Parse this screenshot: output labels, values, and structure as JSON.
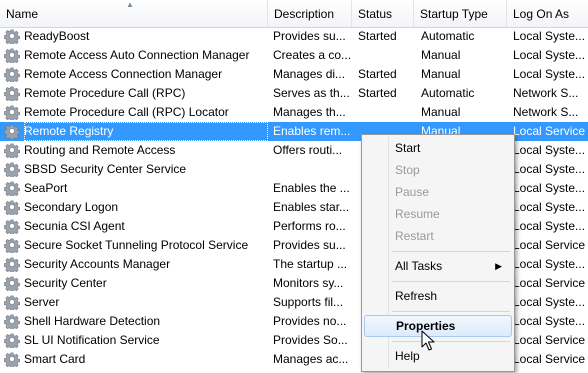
{
  "columns": {
    "name": "Name",
    "description": "Description",
    "status": "Status",
    "startup_type": "Startup Type",
    "log_on_as": "Log On As"
  },
  "services": [
    {
      "name": "ReadyBoost",
      "description": "Provides su...",
      "status": "Started",
      "startup": "Automatic",
      "logon": "Local Syste..."
    },
    {
      "name": "Remote Access Auto Connection Manager",
      "description": "Creates a co...",
      "status": "",
      "startup": "Manual",
      "logon": "Local Syste..."
    },
    {
      "name": "Remote Access Connection Manager",
      "description": "Manages di...",
      "status": "Started",
      "startup": "Manual",
      "logon": "Local Syste..."
    },
    {
      "name": "Remote Procedure Call (RPC)",
      "description": "Serves as th...",
      "status": "Started",
      "startup": "Automatic",
      "logon": "Network S..."
    },
    {
      "name": "Remote Procedure Call (RPC) Locator",
      "description": "Manages th...",
      "status": "",
      "startup": "Manual",
      "logon": "Network S..."
    },
    {
      "name": "Remote Registry",
      "description": "Enables rem...",
      "status": "",
      "startup": "Manual",
      "logon": "Local Service"
    },
    {
      "name": "Routing and Remote Access",
      "description": "Offers routi...",
      "status": "",
      "startup": "",
      "logon": "Local Syste..."
    },
    {
      "name": "SBSD Security Center Service",
      "description": "",
      "status": "",
      "startup": "",
      "logon": "Local Syste..."
    },
    {
      "name": "SeaPort",
      "description": "Enables the ...",
      "status": "",
      "startup": "",
      "logon": "Local Syste..."
    },
    {
      "name": "Secondary Logon",
      "description": "Enables star...",
      "status": "",
      "startup": "",
      "logon": "Local Syste..."
    },
    {
      "name": "Secunia CSI Agent",
      "description": "Performs ro...",
      "status": "",
      "startup": "",
      "logon": "Local Syste..."
    },
    {
      "name": "Secure Socket Tunneling Protocol Service",
      "description": "Provides su...",
      "status": "",
      "startup": "",
      "logon": "Local Service"
    },
    {
      "name": "Security Accounts Manager",
      "description": "The startup ...",
      "status": "",
      "startup": "",
      "logon": "Local Syste..."
    },
    {
      "name": "Security Center",
      "description": "Monitors sy...",
      "status": "",
      "startup": "",
      "logon": "Local Service"
    },
    {
      "name": "Server",
      "description": "Supports fil...",
      "status": "",
      "startup": "",
      "logon": "Local Syste..."
    },
    {
      "name": "Shell Hardware Detection",
      "description": "Provides no...",
      "status": "",
      "startup": "",
      "logon": "Local Syste..."
    },
    {
      "name": "SL UI Notification Service",
      "description": "Provides So...",
      "status": "",
      "startup": "",
      "logon": "Local Service"
    },
    {
      "name": "Smart Card",
      "description": "Manages ac...",
      "status": "",
      "startup": "",
      "logon": "Local Service"
    }
  ],
  "context_menu": {
    "start": "Start",
    "stop": "Stop",
    "pause": "Pause",
    "resume": "Resume",
    "restart": "Restart",
    "all_tasks": "All Tasks",
    "refresh": "Refresh",
    "properties": "Properties",
    "help": "Help"
  },
  "colors": {
    "selection": "#3399ff",
    "menu_hover": "#dcebfc"
  },
  "icons": {
    "service": "gear-icon",
    "submenu": "submenu-arrow-icon",
    "sort": "sort-ascending-icon",
    "pointer": "mouse-pointer-icon"
  }
}
